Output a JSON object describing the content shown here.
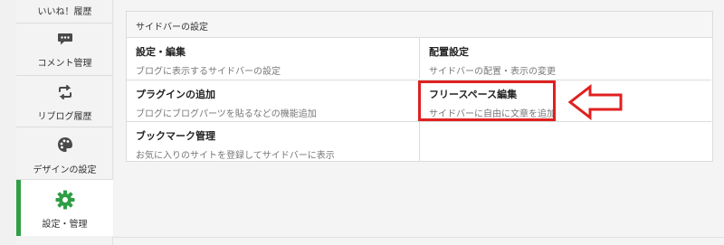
{
  "sidebar": {
    "items": [
      {
        "label": "いいね！履歴",
        "icon": "none"
      },
      {
        "label": "コメント管理",
        "icon": "comment-icon"
      },
      {
        "label": "リブログ履歴",
        "icon": "reblog-icon"
      },
      {
        "label": "デザインの設定",
        "icon": "palette-icon"
      },
      {
        "label": "設定・管理",
        "icon": "gear-icon",
        "active": true
      }
    ],
    "accent_color": "#2f9e45"
  },
  "panel": {
    "title": "サイドバーの設定",
    "cells": [
      {
        "title": "設定・編集",
        "desc": "ブログに表示するサイドバーの設定"
      },
      {
        "title": "配置設定",
        "desc": "サイドバーの配置・表示の変更"
      },
      {
        "title": "プラグインの追加",
        "desc": "ブログにブログパーツを貼るなどの機能追加"
      },
      {
        "title": "フリースペース編集",
        "desc": "サイドバーに自由に文章を追加"
      },
      {
        "title": "ブックマーク管理",
        "desc": "お気に入りのサイトを登録してサイドバーに表示"
      }
    ]
  },
  "annotation": {
    "highlight_color": "#e02020",
    "arrow": "left-arrow-icon"
  }
}
